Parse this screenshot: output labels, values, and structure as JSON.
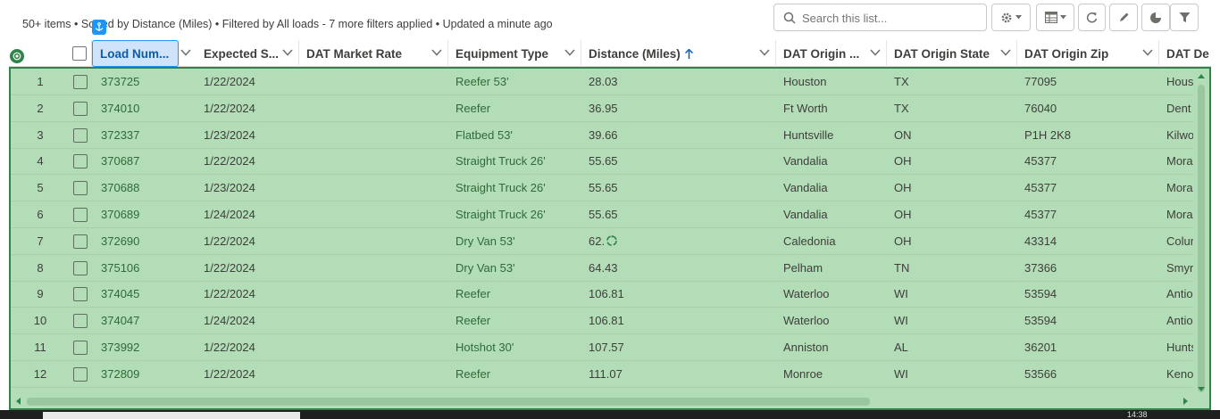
{
  "status_line": "50+ items • Sorted by Distance (Miles) • Filtered by All loads - 7 more filters applied • Updated a minute ago",
  "search": {
    "placeholder": "Search this list..."
  },
  "toolbar_icons": [
    "gear-icon",
    "table-icon",
    "refresh-icon",
    "pencil-icon",
    "pie-chart-icon",
    "filter-icon"
  ],
  "columns": [
    {
      "key": "load_number",
      "label": "Load Num..."
    },
    {
      "key": "expected_ship",
      "label": "Expected S..."
    },
    {
      "key": "dat_market_rate",
      "label": "DAT Market Rate"
    },
    {
      "key": "equipment_type",
      "label": "Equipment Type"
    },
    {
      "key": "distance",
      "label": "Distance (Miles)",
      "sort": "ascending"
    },
    {
      "key": "origin_city",
      "label": "DAT Origin ..."
    },
    {
      "key": "origin_state",
      "label": "DAT Origin State"
    },
    {
      "key": "origin_zip",
      "label": "DAT Origin Zip"
    },
    {
      "key": "dest",
      "label": "DAT De"
    }
  ],
  "rows": [
    {
      "n": "1",
      "load": "373725",
      "date": "1/22/2024",
      "rate": "",
      "equip": "Reefer 53'",
      "dist": "28.03",
      "city": "Houston",
      "state": "TX",
      "zip": "77095",
      "dest": "Hous"
    },
    {
      "n": "2",
      "load": "374010",
      "date": "1/22/2024",
      "rate": "",
      "equip": "Reefer",
      "dist": "36.95",
      "city": "Ft Worth",
      "state": "TX",
      "zip": "76040",
      "dest": "Dent"
    },
    {
      "n": "3",
      "load": "372337",
      "date": "1/23/2024",
      "rate": "",
      "equip": "Flatbed 53'",
      "dist": "39.66",
      "city": "Huntsville",
      "state": "ON",
      "zip": "P1H 2K8",
      "dest": "Kilwo"
    },
    {
      "n": "4",
      "load": "370687",
      "date": "1/22/2024",
      "rate": "",
      "equip": "Straight Truck 26'",
      "dist": "55.65",
      "city": "Vandalia",
      "state": "OH",
      "zip": "45377",
      "dest": "Mora"
    },
    {
      "n": "5",
      "load": "370688",
      "date": "1/23/2024",
      "rate": "",
      "equip": "Straight Truck 26'",
      "dist": "55.65",
      "city": "Vandalia",
      "state": "OH",
      "zip": "45377",
      "dest": "Mora"
    },
    {
      "n": "6",
      "load": "370689",
      "date": "1/24/2024",
      "rate": "",
      "equip": "Straight Truck 26'",
      "dist": "55.65",
      "city": "Vandalia",
      "state": "OH",
      "zip": "45377",
      "dest": "Mora"
    },
    {
      "n": "7",
      "load": "372690",
      "date": "1/22/2024",
      "rate": "",
      "equip": "Dry Van 53'",
      "dist": "62.",
      "city": "Caledonia",
      "state": "OH",
      "zip": "43314",
      "dest": "Colur"
    },
    {
      "n": "8",
      "load": "375106",
      "date": "1/22/2024",
      "rate": "",
      "equip": "Dry Van 53'",
      "dist": "64.43",
      "city": "Pelham",
      "state": "TN",
      "zip": "37366",
      "dest": "Smyr"
    },
    {
      "n": "9",
      "load": "374045",
      "date": "1/22/2024",
      "rate": "",
      "equip": "Reefer",
      "dist": "106.81",
      "city": "Waterloo",
      "state": "WI",
      "zip": "53594",
      "dest": "Antio"
    },
    {
      "n": "10",
      "load": "374047",
      "date": "1/24/2024",
      "rate": "",
      "equip": "Reefer",
      "dist": "106.81",
      "city": "Waterloo",
      "state": "WI",
      "zip": "53594",
      "dest": "Antio"
    },
    {
      "n": "11",
      "load": "373992",
      "date": "1/22/2024",
      "rate": "",
      "equip": "Hotshot 30'",
      "dist": "107.57",
      "city": "Anniston",
      "state": "AL",
      "zip": "36201",
      "dest": "Hunts"
    },
    {
      "n": "12",
      "load": "372809",
      "date": "1/22/2024",
      "rate": "",
      "equip": "Reefer",
      "dist": "111.07",
      "city": "Monroe",
      "state": "WI",
      "zip": "53566",
      "dest": "Keno"
    }
  ],
  "taskbar": {
    "time": "14:38"
  },
  "colors": {
    "selection_fill": "#b3ddb6",
    "selection_border": "#2e844a",
    "link": "#2e6b39",
    "active_header": "#cfe3fa",
    "accent": "#1b96ff"
  }
}
